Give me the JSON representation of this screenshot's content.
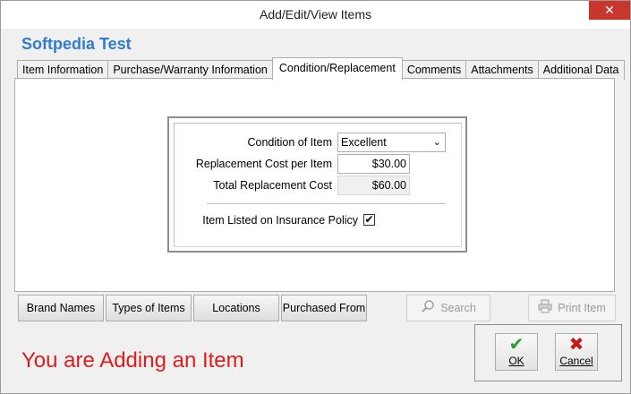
{
  "window": {
    "title": "Add/Edit/View Items",
    "close_glyph": "✕"
  },
  "app": {
    "title": "Softpedia Test"
  },
  "tabs": [
    {
      "label": "Item Information"
    },
    {
      "label": "Purchase/Warranty Information"
    },
    {
      "label": "Condition/Replacement"
    },
    {
      "label": "Comments"
    },
    {
      "label": "Attachments"
    },
    {
      "label": "Additional Data"
    }
  ],
  "form": {
    "condition_label": "Condition of Item",
    "condition_value": "Excellent",
    "replacement_cost_label": "Replacement Cost per Item",
    "replacement_cost_value": "$30.00",
    "total_cost_label": "Total Replacement Cost",
    "total_cost_value": "$60.00",
    "insurance_label": "Item Listed on Insurance Policy",
    "insurance_checked": "✔"
  },
  "buttons": {
    "brand_names": "Brand Names",
    "types_of_items": "Types of Items",
    "locations": "Locations",
    "purchased_from": "Purchased From",
    "search": "Search",
    "print_item": "Print Item"
  },
  "status": {
    "text": "You are Adding an Item"
  },
  "actions": {
    "ok_label": "OK",
    "ok_glyph": "✔",
    "cancel_label": "Cancel",
    "cancel_glyph": "✖"
  },
  "colors": {
    "accent_blue": "#2f7bd6",
    "status_red": "#e01b1b",
    "ok_green": "#2e9a2e",
    "cancel_red": "#c41a1a"
  }
}
